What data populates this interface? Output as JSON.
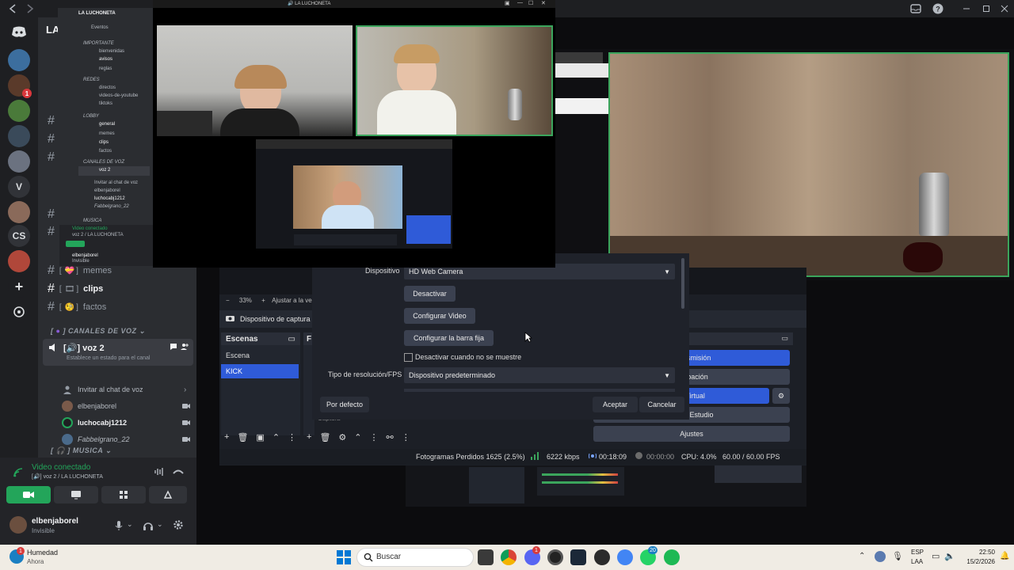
{
  "topbar": {
    "server_header": "LA LUCHONETA"
  },
  "overlay": {
    "title": "LA LUCHONETA"
  },
  "mini_discord": {
    "server": "LA LUCHONETA",
    "events": "Eventos",
    "cat_importante": "IMPORTANTE",
    "ch_bienvenidas": "bienvenidas",
    "ch_avisos": "avisos",
    "ch_reglas": "reglas",
    "cat_redes": "REDES",
    "ch_directos": "directos",
    "ch_videos": "videos-de-youtube",
    "ch_tiktoks": "tiktoks",
    "cat_lobby": "LOBBY",
    "ch_general": "general",
    "ch_memes": "memes",
    "ch_clips": "clips",
    "ch_factos": "factos",
    "cat_voz": "CANALES DE VOZ",
    "voz2": "voz 2",
    "invite": "Invitar al chat de voz",
    "u1": "elbenjaborel",
    "u2": "luchocabj1212",
    "u3": "Fabbelgrano_22",
    "cat_musica": "MUSICA",
    "video_conectado": "Video conectado",
    "voz_path": "voz 2 / LA LUCHONETA",
    "user": "elbenjaborel",
    "status": "Invisible"
  },
  "sidebar": {
    "server_initial": "LA",
    "servers": [
      "V",
      "CS"
    ],
    "badge": "1",
    "channels": [
      {
        "label": "memes",
        "emoji": "💝"
      },
      {
        "label": "clips",
        "emoji": "🎞"
      },
      {
        "label": "factos",
        "emoji": "🧐"
      }
    ],
    "voice_category": "CANALES DE VOZ",
    "voice_channel": "voz 2",
    "voice_status": "Establece un estado para el canal",
    "invite_label": "Invitar al chat de voz",
    "voice_users": [
      "elbenjaborel",
      "luchocabj1212",
      "Fabbelgrano_22"
    ],
    "music_category": "MUSICA"
  },
  "voice_panel": {
    "connected": "Video conectado",
    "path": "voz 2 / LA LUCHONETA",
    "username": "elbenjaborel",
    "status": "Invisible"
  },
  "obs": {
    "zoom": "33%",
    "zoom_adjust": "Ajustar a la ventana",
    "source_name": "Dispositivo de captura",
    "scenes_header": "Escenas",
    "sources_header_short": "F",
    "scenes": [
      "Escena",
      "KICK"
    ],
    "capture_label": "Captura",
    "controls": [
      "Transmisión",
      "Grabación",
      "Cámara Virtual",
      "Modo Estudio",
      "Ajustes"
    ],
    "status": {
      "dropped": "Fotogramas Perdidos 1625 (2.5%)",
      "kbps": "6222 kbps",
      "time_live": "00:18:09",
      "time_rec": "00:00:00",
      "cpu": "CPU: 4.0%",
      "fps": "60.00 / 60.00 FPS"
    }
  },
  "dialog": {
    "device_label": "Dispositivo",
    "device_value": "HD Web Camera",
    "btn_desactivar": "Desactivar",
    "btn_config_video": "Configurar Video",
    "btn_config_barra": "Configurar la barra fija",
    "checkbox_label": "Desactivar cuando no se muestre",
    "resolution_label": "Tipo de resolución/FPS",
    "resolution_value": "Dispositivo predeterminado",
    "btn_default": "Por defecto",
    "btn_accept": "Aceptar",
    "btn_cancel": "Cancelar"
  },
  "taskbar": {
    "weather": "Humedad",
    "weather_sub": "Ahora",
    "search": "Buscar",
    "lang": "ESP",
    "lang_sub": "LAA",
    "time": "22:50",
    "date": "15/2/2026",
    "badge_discord": "1",
    "badge_whatsapp": "20"
  },
  "colors": {
    "discord_bg": "#2b2d31",
    "discord_dark": "#1e1f22",
    "green": "#23a55a",
    "obs_blue": "#2f5bd8",
    "obs_bg": "#1c1f26"
  }
}
